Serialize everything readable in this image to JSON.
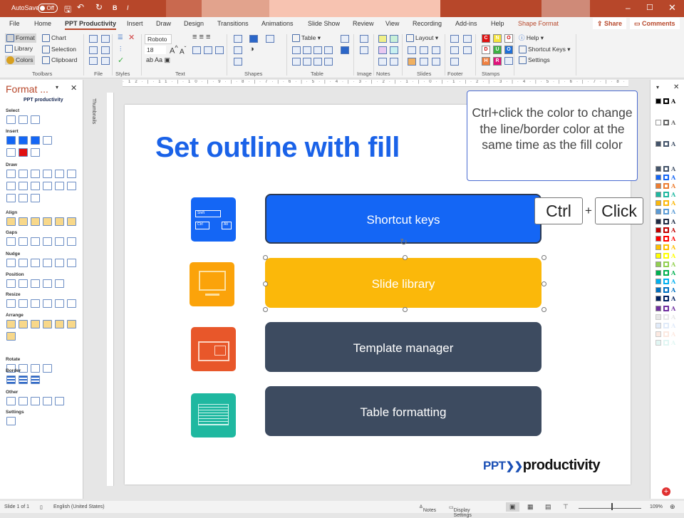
{
  "titlebar": {
    "autosave": "AutoSave",
    "autosave_state": "Off",
    "bold": "B",
    "italic": "I"
  },
  "tabs": [
    "File",
    "Home",
    "PPT Productivity",
    "Insert",
    "Draw",
    "Design",
    "Transitions",
    "Animations",
    "Slide Show",
    "Review",
    "View",
    "Recording",
    "Add-ins",
    "Help",
    "Shape Format"
  ],
  "active_tab": "PPT Productivity",
  "share": "Share",
  "comments": "Comments",
  "ribbon": {
    "toolbars": {
      "format": "Format",
      "library": "Library",
      "colors": "Colors",
      "chart": "Chart",
      "selection": "Selection",
      "clipboard": "Clipboard",
      "label": "Toolbars"
    },
    "file_label": "File",
    "styles_label": "Styles",
    "text": {
      "font": "Roboto",
      "size": "18",
      "label": "Text"
    },
    "shapes_label": "Shapes",
    "table": {
      "table": "Table",
      "label": "Table"
    },
    "image_label": "Image",
    "notes_label": "Notes",
    "slides": {
      "layout": "Layout",
      "label": "Slides"
    },
    "footer_label": "Footer",
    "stamps": {
      "label": "Stamps",
      "letters": [
        "C",
        "N",
        "O",
        "D",
        "U",
        "O",
        "H",
        "R"
      ],
      "colors": [
        "#e01010",
        "#f5e43a",
        "#fff",
        "#fff",
        "#3cb043",
        "#1e6fd9",
        "#f08040",
        "#e0127a"
      ]
    },
    "help": {
      "help": "Help",
      "shortcut_keys": "Shortcut Keys",
      "settings": "Settings"
    }
  },
  "leftpane": {
    "title": "Format ...",
    "logo": "PPT productivity",
    "sections": [
      "Select",
      "Insert",
      "Draw",
      "Align",
      "Gaps",
      "Nudge",
      "Position",
      "Resize",
      "Arrange",
      "Rotate",
      "Border",
      "Other",
      "Settings"
    ]
  },
  "thumbnails_label": "Thumbnails",
  "slide": {
    "title": "Set outline with fill",
    "bars": [
      {
        "label": "Shortcut keys",
        "color": "#1466f5",
        "border": "#2b3a55"
      },
      {
        "label": "Slide library",
        "color": "#fbb80a",
        "border": "#fbb80a"
      },
      {
        "label": "Template manager",
        "color": "#3d4b60",
        "border": "#3d4b60"
      },
      {
        "label": "Table formatting",
        "color": "#3d4b60",
        "border": "#3d4b60"
      }
    ],
    "icon_colors": [
      "#1466f5",
      "#fba30a",
      "#e8572a",
      "#1fb8a0"
    ],
    "icon_texts": {
      "shift": "Shift",
      "ctrl": "Ctrl",
      "alt": "Alt"
    },
    "logo": {
      "ppt": "PPT",
      "productivity": "productivity"
    }
  },
  "callout": "Ctrl+click the color to change the line/border color at the same time as the fill color",
  "keys": {
    "ctrl": "Ctrl",
    "plus": "+",
    "click": "Click"
  },
  "colors_panel": [
    "#000000",
    "#ffffff",
    "#44546a",
    "#e7e6e6",
    "#44546a",
    "#1466f5",
    "#ed7d31",
    "#1fb8a0",
    "#fbb80a",
    "#5b9bd5",
    "#1f2b44",
    "#c00000",
    "#ff0000",
    "#ffc000",
    "#ffff00",
    "#92d050",
    "#00b050",
    "#00b0f0",
    "#0070c0",
    "#002060",
    "#7030a0",
    "#d0d0d0",
    "#c5d8f5",
    "#fbd5c5",
    "#c5efe8",
    "#eeeeee"
  ],
  "statusbar": {
    "slide": "Slide 1 of 1",
    "language": "English (United States)",
    "notes": "Notes",
    "display": "Display Settings",
    "zoom": "109%"
  }
}
